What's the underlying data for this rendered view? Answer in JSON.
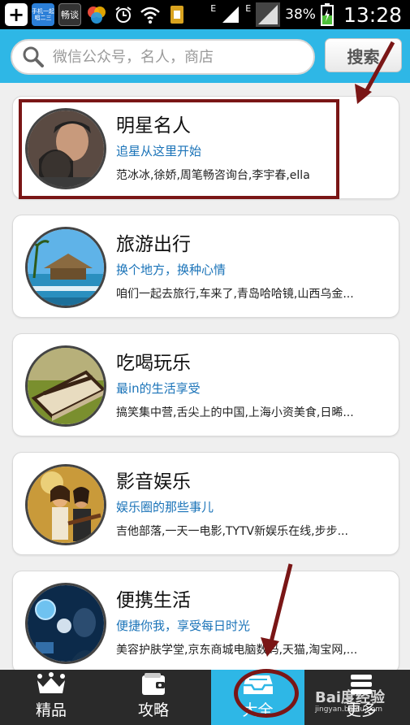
{
  "status_bar": {
    "app_blue_text": "手机一起\n唱二三",
    "app_dark_text": "畅谈",
    "network_e_1": "E",
    "network_e_2": "E",
    "battery_percent": "38%",
    "time": "13:28"
  },
  "search": {
    "placeholder": "微信公众号，名人，商店",
    "button_label": "搜索"
  },
  "categories": [
    {
      "title": "明星名人",
      "subtitle": "追星从这里开始",
      "desc": "范冰冰,徐娇,周笔畅咨询台,李宇春,ella",
      "avatar": "celebrity-photo"
    },
    {
      "title": "旅游出行",
      "subtitle": "换个地方，换种心情",
      "desc": "咱们一起去旅行,车来了,青岛哈哈镜,山西乌金...",
      "avatar": "resort-photo"
    },
    {
      "title": "吃喝玩乐",
      "subtitle": "最in的生活享受",
      "desc": "搞笑集中营,舌尖上的中国,上海小资美食,日晞...",
      "avatar": "cake-photo"
    },
    {
      "title": "影音娱乐",
      "subtitle": "娱乐圈的那些事儿",
      "desc": "吉他部落,一天一电影,TYTV新娱乐在线,步步...",
      "avatar": "concert-photo"
    },
    {
      "title": "便携生活",
      "subtitle": "便捷你我，享受每日时光",
      "desc": "美容护肤学堂,京东商城电脑数码,天猫,淘宝网,...",
      "avatar": "tech-photo"
    }
  ],
  "tabs": [
    {
      "label": "精品",
      "icon": "crown-icon"
    },
    {
      "label": "攻略",
      "icon": "wallet-icon"
    },
    {
      "label": "大全",
      "icon": "inbox-icon"
    },
    {
      "label": "更多",
      "icon": "more-icon"
    }
  ],
  "watermark": {
    "brand": "Bai度经验",
    "url": "jingyan.baidu.com"
  },
  "colors": {
    "accent": "#2eb7e6",
    "annotation": "#7a1616",
    "link_blue": "#1a73b8",
    "tabbar": "#2a2a2a"
  }
}
